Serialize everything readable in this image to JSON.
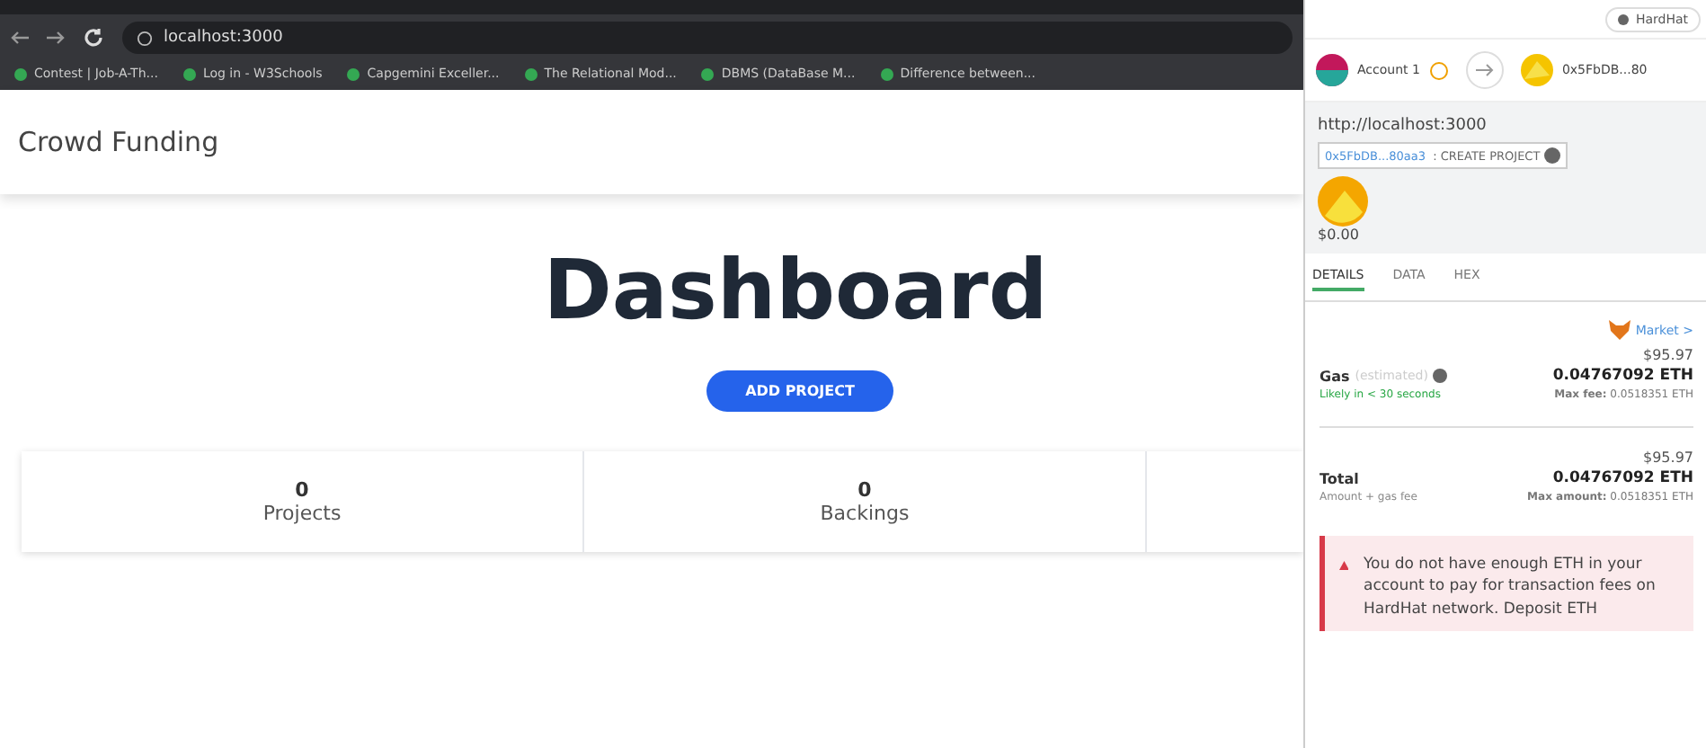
{
  "browser": {
    "address": "localhost:3000",
    "bookmarks": [
      {
        "label": "Contest | Job-A-Th..."
      },
      {
        "label": "Log in - W3Schools"
      },
      {
        "label": "Capgemini Exceller..."
      },
      {
        "label": "The Relational Mod..."
      },
      {
        "label": "DBMS (DataBase M..."
      },
      {
        "label": "Difference between..."
      }
    ]
  },
  "page": {
    "brand": "Crowd Funding",
    "heading": "Dashboard",
    "add_button": "ADD PROJECT",
    "stats": [
      {
        "value": "0",
        "label": "Projects"
      },
      {
        "value": "0",
        "label": "Backings"
      }
    ]
  },
  "wallet": {
    "network": "HardHat",
    "account": "Account 1",
    "recipient": "0x5FbDB...80",
    "origin": "http://localhost:3000",
    "contract": "0x5FbDB...80aa3",
    "method": ": CREATE PROJECT",
    "amount": "$0.00",
    "tabs": [
      {
        "label": "DETAILS",
        "selected": true
      },
      {
        "label": "DATA",
        "selected": false
      },
      {
        "label": "HEX",
        "selected": false
      }
    ],
    "market": "Market >",
    "gas": {
      "label": "Gas",
      "note": "(estimated)",
      "fiat": "$95.97",
      "eth": "0.04767092 ETH",
      "speed": "Likely in < 30 seconds",
      "max": "**Max fee:** 0.0518351 ETH"
    },
    "total": {
      "label": "Total",
      "fiat": "$95.97",
      "eth": "0.04767092 ETH",
      "note": "Amount + gas fee",
      "max": "**Max amount:** 0.0518351 ETH"
    },
    "warning": "You do not have enough ETH in your account to pay for transaction fees on HardHat network. Deposit ETH"
  }
}
